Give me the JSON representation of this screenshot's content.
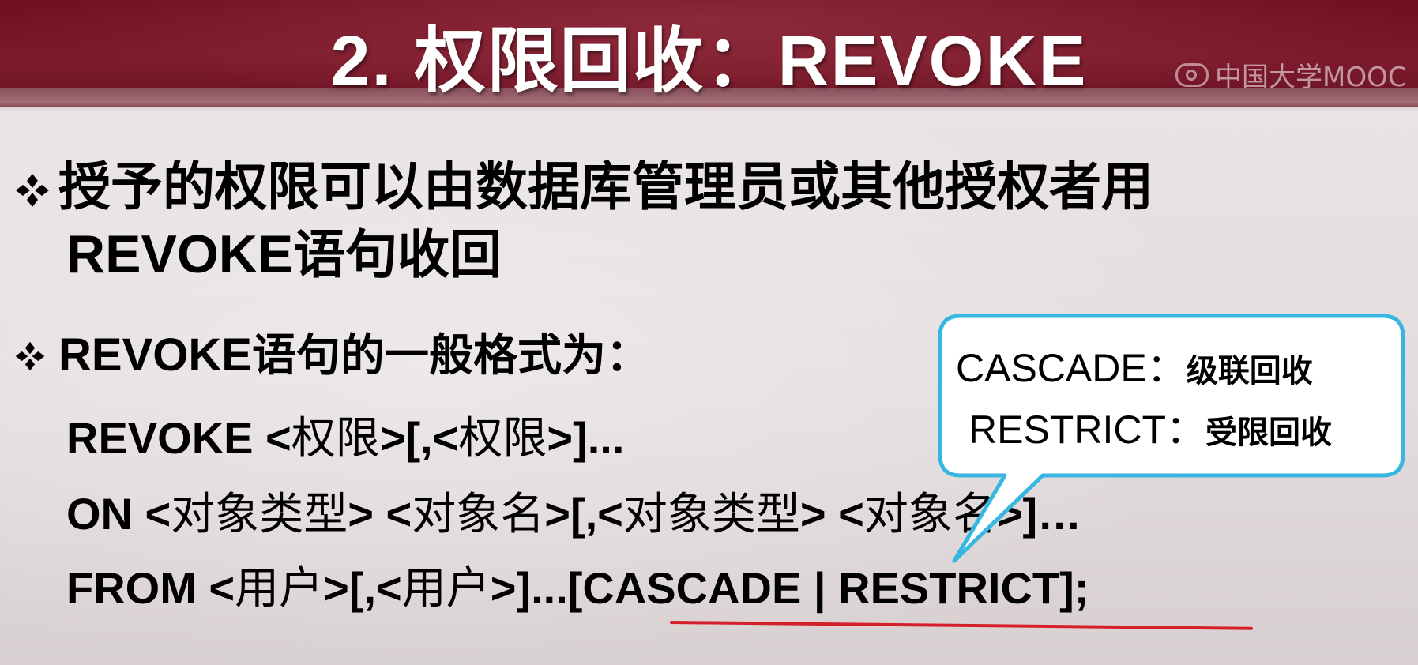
{
  "slide": {
    "title": "2. 权限回收：REVOKE",
    "watermark": "中国大学MOOC",
    "bullet1": {
      "line1": "授予的权限可以由数据库管理员或其他授权者用",
      "line2_en": "REVOKE",
      "line2_cn": "语句收回"
    },
    "bullet2": {
      "en": "REVOKE",
      "cn": "语句的一般格式为："
    },
    "syntax": {
      "line1": [
        {
          "t": "REVOKE <",
          "cn": false
        },
        {
          "t": "权限",
          "cn": true
        },
        {
          "t": ">[,<",
          "cn": false
        },
        {
          "t": "权限",
          "cn": true
        },
        {
          "t": ">]...",
          "cn": false
        }
      ],
      "line2": [
        {
          "t": "ON <",
          "cn": false
        },
        {
          "t": "对象类型",
          "cn": true
        },
        {
          "t": "> <",
          "cn": false
        },
        {
          "t": "对象名",
          "cn": true
        },
        {
          "t": ">[,<",
          "cn": false
        },
        {
          "t": "对象类型",
          "cn": true
        },
        {
          "t": "> <",
          "cn": false
        },
        {
          "t": "对象名",
          "cn": true
        },
        {
          "t": ">]…",
          "cn": false
        }
      ],
      "line3": [
        {
          "t": "FROM <",
          "cn": false
        },
        {
          "t": "用户",
          "cn": true
        },
        {
          "t": ">[,<",
          "cn": false
        },
        {
          "t": "用户",
          "cn": true
        },
        {
          "t": ">]...[CASCADE | RESTRICT];",
          "cn": false
        }
      ]
    },
    "callout": {
      "line1_en": "CASCADE：",
      "line1_cn": "级联回收",
      "line2_en": "RESTRICT：",
      "line2_cn": "受限回收"
    },
    "colors": {
      "header": "#7d1a2c",
      "underline": "#d4202a",
      "callout_border": "#36b6e0"
    },
    "icons": [
      "diamond-bullet-icon",
      "mooc-logo-icon"
    ]
  }
}
